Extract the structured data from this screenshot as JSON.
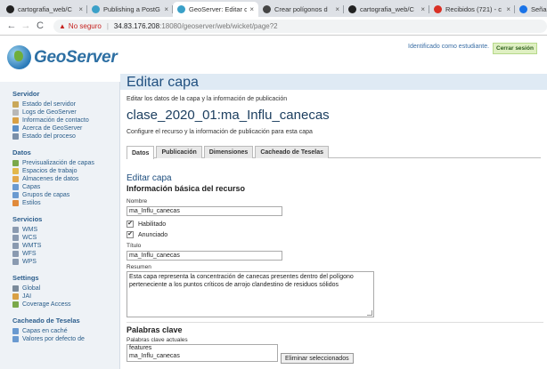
{
  "browser": {
    "tabs": [
      {
        "label": "cartografia_web/C",
        "close": "×",
        "icon": "github-icon",
        "color": "#222222"
      },
      {
        "label": "Publishing a PostG",
        "close": "×",
        "icon": "geoserver-icon",
        "color": "#3aa0c8"
      },
      {
        "label": "GeoServer: Editar c",
        "close": "×",
        "icon": "geoserver-icon",
        "color": "#3aa0c8"
      },
      {
        "label": "Crear polígonos d",
        "close": "×",
        "icon": "globe-icon",
        "color": "#444444"
      },
      {
        "label": "cartografia_web/C",
        "close": "×",
        "icon": "github-icon",
        "color": "#222222"
      },
      {
        "label": "Recibidos (721) - c",
        "close": "×",
        "icon": "gmail-icon",
        "color": "#d93025"
      },
      {
        "label": "Señal en Vi",
        "close": "",
        "icon": "signal-icon",
        "color": "#1a73e8"
      }
    ],
    "address": {
      "back": "←",
      "forward": "→",
      "reload": "C",
      "warning_icon": "▲",
      "security": "No seguro",
      "separator": "|",
      "host": "34.83.176.208",
      "path": ":18080/geoserver/web/wicket/page?2"
    }
  },
  "header": {
    "logo": "GeoServer",
    "user": "Identificado como estudiante.",
    "logout": "Cerrar sesión"
  },
  "sidebar": {
    "sections": [
      {
        "title": "Servidor",
        "items": [
          {
            "label": "Estado del servidor",
            "icon": "server-status-icon",
            "color": "#c9a85a"
          },
          {
            "label": "Logs de GeoServer",
            "icon": "log-icon",
            "color": "#b8b8b8"
          },
          {
            "label": "Información de contacto",
            "icon": "contact-icon",
            "color": "#d9a044"
          },
          {
            "label": "Acerca de GeoServer",
            "icon": "about-icon",
            "color": "#5b8fc7"
          },
          {
            "label": "Estado del proceso",
            "icon": "process-icon",
            "color": "#7a8fa8"
          }
        ]
      },
      {
        "title": "Datos",
        "items": [
          {
            "label": "Previsualización de capas",
            "icon": "layer-preview-icon",
            "color": "#7aa84a"
          },
          {
            "label": "Espacios de trabajo",
            "icon": "folder-icon",
            "color": "#e2b84c"
          },
          {
            "label": "Almacenes de datos",
            "icon": "store-icon",
            "color": "#e2a84c"
          },
          {
            "label": "Capas",
            "icon": "layers-icon",
            "color": "#6a9ad0"
          },
          {
            "label": "Grupos de capas",
            "icon": "layer-group-icon",
            "color": "#6a9ad0"
          },
          {
            "label": "Estilos",
            "icon": "style-icon",
            "color": "#e08a3a"
          }
        ]
      },
      {
        "title": "Servicios",
        "items": [
          {
            "label": "WMS",
            "icon": "wms-icon",
            "color": "#8a9ab0"
          },
          {
            "label": "WCS",
            "icon": "wcs-icon",
            "color": "#8a9ab0"
          },
          {
            "label": "WMTS",
            "icon": "wmts-icon",
            "color": "#8a9ab0"
          },
          {
            "label": "WFS",
            "icon": "wfs-icon",
            "color": "#8a9ab0"
          },
          {
            "label": "WPS",
            "icon": "wps-icon",
            "color": "#8a9ab0"
          }
        ]
      },
      {
        "title": "Settings",
        "items": [
          {
            "label": "Global",
            "icon": "global-settings-icon",
            "color": "#7a8a9a"
          },
          {
            "label": "JAI",
            "icon": "jai-icon",
            "color": "#d9a044"
          },
          {
            "label": "Coverage Access",
            "icon": "coverage-icon",
            "color": "#7aa84a"
          }
        ]
      },
      {
        "title": "Cacheado de Teselas",
        "items": [
          {
            "label": "Capas en caché",
            "icon": "cached-layers-icon",
            "color": "#6a9ad0"
          },
          {
            "label": "Valores por defecto de",
            "icon": "defaults-icon",
            "color": "#6a9ad0"
          }
        ]
      }
    ]
  },
  "main": {
    "title": "Editar capa",
    "description": "Editar los datos de la capa y la información de publicación",
    "layer_title": "clase_2020_01:ma_Influ_canecas",
    "subtitle": "Configure el recurso y la información de publicación para esta capa",
    "tabs": [
      "Datos",
      "Publicación",
      "Dimensiones",
      "Cacheado de Teselas"
    ],
    "section_title": "Editar capa",
    "basic_info": "Información básica del recurso",
    "name_label": "Nombre",
    "name_value": "ma_Influ_canecas",
    "enabled_label": "Habilitado",
    "advertised_label": "Anunciado",
    "check_mark": "✔",
    "title_label": "Título",
    "title_value": "ma_Influ_canecas",
    "abstract_label": "Resumen",
    "abstract_value": "Esta capa representa la concentración de canecas presentes dentro del polígono perteneciente a los puntos críticos de arrojo clandestino de residuos sólidos",
    "keywords_title": "Palabras clave",
    "current_keywords_label": "Palabras clave actuales",
    "keywords": [
      "features",
      "ma_Influ_canecas"
    ],
    "remove_button": "Eliminar seleccionados"
  }
}
